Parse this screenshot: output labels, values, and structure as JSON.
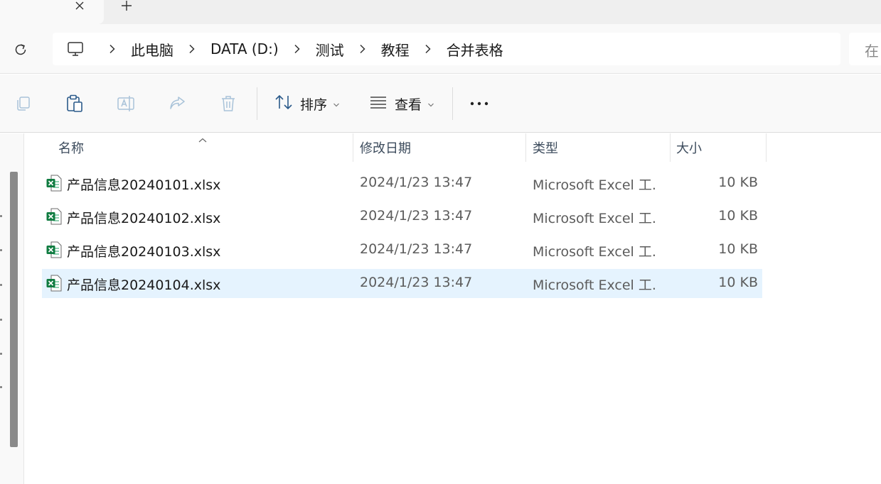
{
  "tabs": {
    "close_icon": "close-icon",
    "new_tab_icon": "plus-icon"
  },
  "address": {
    "home_icon": "computer-icon",
    "segments": [
      {
        "label": "此电脑"
      },
      {
        "label": "DATA (D:)"
      },
      {
        "label": "测试"
      },
      {
        "label": "教程"
      },
      {
        "label": "合并表格"
      }
    ],
    "search_text": "在"
  },
  "toolbar": {
    "sort_label": "排序",
    "view_label": "查看",
    "more_label": "···"
  },
  "columns": {
    "name": "名称",
    "date": "修改日期",
    "type": "类型",
    "size": "大小"
  },
  "files": [
    {
      "name": "产品信息20240101.xlsx",
      "date": "2024/1/23 13:47",
      "type": "Microsoft Excel 工...",
      "size": "10 KB",
      "selected": false
    },
    {
      "name": "产品信息20240102.xlsx",
      "date": "2024/1/23 13:47",
      "type": "Microsoft Excel 工...",
      "size": "10 KB",
      "selected": false
    },
    {
      "name": "产品信息20240103.xlsx",
      "date": "2024/1/23 13:47",
      "type": "Microsoft Excel 工...",
      "size": "10 KB",
      "selected": false
    },
    {
      "name": "产品信息20240104.xlsx",
      "date": "2024/1/23 13:47",
      "type": "Microsoft Excel 工...",
      "size": "10 KB",
      "selected": true
    }
  ],
  "colors": {
    "accent": "#0067c0",
    "selection": "#e5f3fe",
    "excel_green": "#107c41"
  }
}
